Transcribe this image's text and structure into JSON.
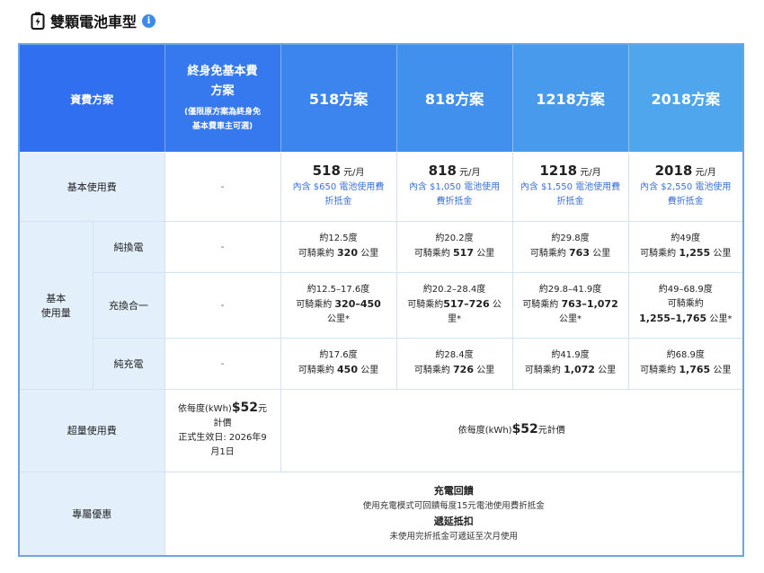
{
  "page": {
    "title": "雙顆電池車型"
  },
  "header": {
    "label": "資費方案",
    "free_plan_title_1": "終身免基本費",
    "free_plan_title_2": "方案",
    "free_plan_note_1": "(僅限原方案為終身免",
    "free_plan_note_2": "基本費車主可選)",
    "plans": [
      "518方案",
      "818方案",
      "1218方案",
      "2018方案"
    ]
  },
  "colors": {
    "header_gradient_start": "#2f6ff0",
    "header_gradient_end": "#52a9ec",
    "side_bg": "#e3f0fc",
    "note_blue": "#3a72d8"
  },
  "rows": {
    "base_fee": {
      "label": "基本使用費",
      "free": "-",
      "plans": [
        {
          "price": "518",
          "unit": "元/月",
          "note_1": "內含 $650 電池使用費",
          "note_2": "折抵金"
        },
        {
          "price": "818",
          "unit": "元/月",
          "note_1": "內含 $1,050 電池使用",
          "note_2": "費折抵金"
        },
        {
          "price": "1218",
          "unit": "元/月",
          "note_1": "內含 $1,550 電池使用費",
          "note_2": "折抵金"
        },
        {
          "price": "2018",
          "unit": "元/月",
          "note_1": "內含 $2,550 電池使用",
          "note_2": "費折抵金"
        }
      ]
    },
    "usage_group_label_1": "基本",
    "usage_group_label_2": "使用量",
    "swap": {
      "label": "純換電",
      "free": "-",
      "plans": [
        {
          "line1": "約12.5度",
          "pre": "可騎乘約",
          "km": "320",
          "post": "公里"
        },
        {
          "line1": "約20.2度",
          "pre": "可騎乘約",
          "km": "517",
          "post": "公里"
        },
        {
          "line1": "約29.8度",
          "pre": "可騎乘約",
          "km": "763",
          "post": "公里"
        },
        {
          "line1": "約49度",
          "pre": "可騎乘約",
          "km": "1,255",
          "post": "公里"
        }
      ]
    },
    "combo": {
      "label": "充換合一",
      "free": "-",
      "plans": [
        {
          "line1": "約12.5–17.6度",
          "line2_pre": "可騎乘約",
          "line2_bold": "320–450",
          "line3": "公里*"
        },
        {
          "line1": "約20.2–28.4度",
          "line2_pre": "可騎乘約",
          "line2_bold": "517–726",
          "line2_post": "公",
          "line3": "里*"
        },
        {
          "line1": "約29.8–41.9度",
          "line2_pre": "可騎乘約",
          "line2_bold": "763–1,072",
          "line3": "公里*"
        },
        {
          "line1": "約49–68.9度",
          "line2_pre": "可騎乘約",
          "line3_bold": "1,255–1,765",
          "line3": "公里*"
        }
      ]
    },
    "charge": {
      "label": "純充電",
      "free": "-",
      "plans": [
        {
          "line1": "約17.6度",
          "pre": "可騎乘約",
          "km": "450",
          "post": "公里"
        },
        {
          "line1": "約28.4度",
          "pre": "可騎乘約",
          "km": "726",
          "post": "公里"
        },
        {
          "line1": "約41.9度",
          "pre": "可騎乘約",
          "km": "1,072",
          "post": "公里"
        },
        {
          "line1": "約68.9度",
          "pre": "可騎乘約",
          "km": "1,765",
          "post": "公里"
        }
      ]
    },
    "overage": {
      "label": "超量使用費",
      "free_pre": "依每度(kWh)",
      "free_price": "$52",
      "free_post": "元",
      "free_line2": "計價",
      "free_line3": "正式生效日: 2026年9",
      "free_line4": "月1日",
      "plans_pre": "依每度(kWh)",
      "plans_price": "$52",
      "plans_post": "元計價"
    },
    "perks": {
      "label": "專屬優惠",
      "title_1": "充電回饋",
      "desc_1": "使用充電模式可回饋每度15元電池使用費折抵金",
      "title_2": "遞延抵扣",
      "desc_2": "未使用完折抵金可遞延至次月使用"
    }
  }
}
